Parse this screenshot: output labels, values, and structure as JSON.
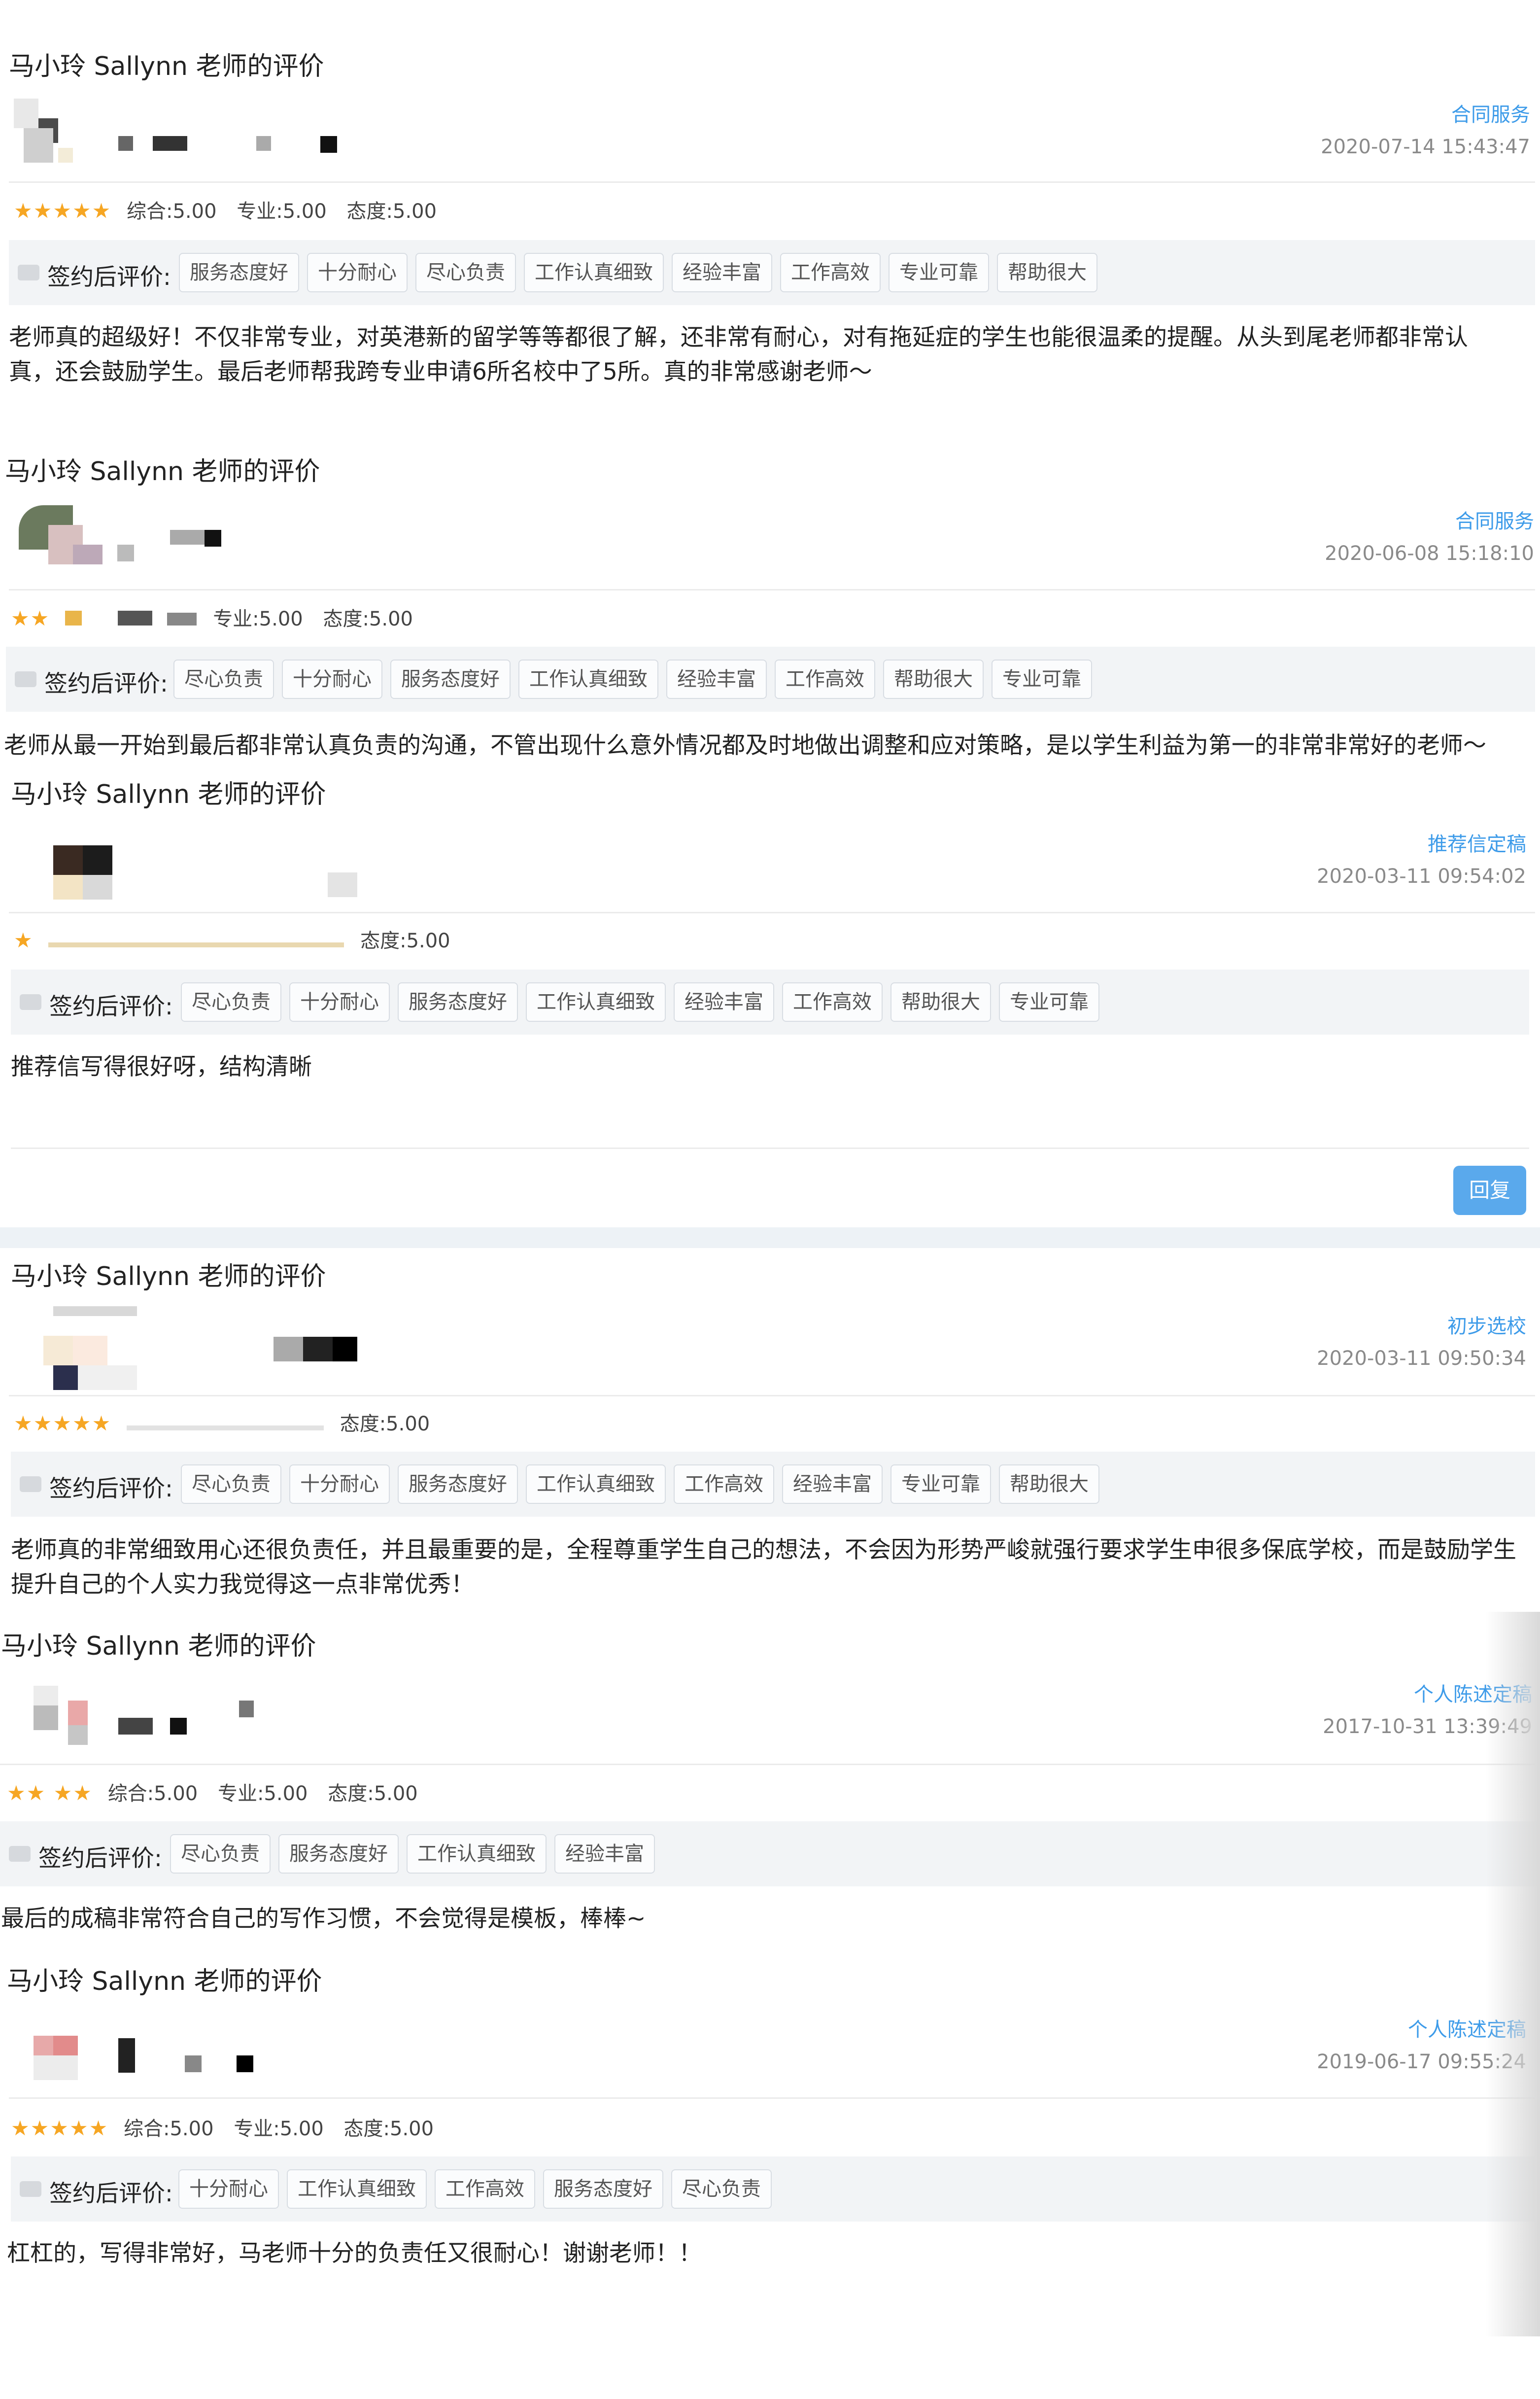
{
  "colors": {
    "accent": "#3d9be9",
    "star": "#f6a623",
    "tag_bar": "#f2f4f6",
    "button": "#5aa9ec"
  },
  "reviews": [
    {
      "title": "马小玲 Sallynn 老师的评价",
      "service": "合同服务",
      "date": "2020-07-14 15:43:47",
      "scores": {
        "overall": "综合:5.00",
        "professional": "专业:5.00",
        "attitude": "态度:5.00"
      },
      "tag_label": "签约后评价:",
      "tags": [
        "服务态度好",
        "十分耐心",
        "尽心负责",
        "工作认真细致",
        "经验丰富",
        "工作高效",
        "专业可靠",
        "帮助很大"
      ],
      "text": "老师真的超级好！不仅非常专业，对英港新的留学等等都很了解，还非常有耐心，对有拖延症的学生也能很温柔的提醒。从头到尾老师都非常认真，还会鼓励学生。最后老师帮我跨专业申请6所名校中了5所。真的非常感谢老师～"
    },
    {
      "title": "马小玲 Sallynn 老师的评价",
      "service": "合同服务",
      "date": "2020-06-08 15:18:10",
      "scores": {
        "overall": "",
        "professional": "专业:5.00",
        "attitude": "态度:5.00"
      },
      "tag_label": "签约后评价:",
      "tags": [
        "尽心负责",
        "十分耐心",
        "服务态度好",
        "工作认真细致",
        "经验丰富",
        "工作高效",
        "帮助很大",
        "专业可靠"
      ],
      "text": "老师从最一开始到最后都非常认真负责的沟通，不管出现什么意外情况都及时地做出调整和应对策略，是以学生利益为第一的非常非常好的老师～"
    },
    {
      "title": "马小玲 Sallynn 老师的评价",
      "service": "推荐信定稿",
      "date": "2020-03-11 09:54:02",
      "scores": {
        "overall": "",
        "professional": "",
        "attitude": "态度:5.00"
      },
      "tag_label": "签约后评价:",
      "tags": [
        "尽心负责",
        "十分耐心",
        "服务态度好",
        "工作认真细致",
        "经验丰富",
        "工作高效",
        "帮助很大",
        "专业可靠"
      ],
      "text": "推荐信写得很好呀，结构清晰",
      "reply": "回复"
    },
    {
      "title": "马小玲 Sallynn 老师的评价",
      "service": "初步选校",
      "date": "2020-03-11 09:50:34",
      "scores": {
        "overall": "",
        "professional": "",
        "attitude": "态度:5.00"
      },
      "tag_label": "签约后评价:",
      "tags": [
        "尽心负责",
        "十分耐心",
        "服务态度好",
        "工作认真细致",
        "工作高效",
        "经验丰富",
        "专业可靠",
        "帮助很大"
      ],
      "text": "老师真的非常细致用心还很负责任，并且最重要的是，全程尊重学生自己的想法，不会因为形势严峻就强行要求学生申很多保底学校，而是鼓励学生提升自己的个人实力我觉得这一点非常优秀！"
    },
    {
      "title": "马小玲 Sallynn 老师的评价",
      "service": "个人陈述定稿",
      "date": "2017-10-31 13:39:49",
      "scores": {
        "overall": "综合:5.00",
        "professional": "专业:5.00",
        "attitude": "态度:5.00"
      },
      "tag_label": "签约后评价:",
      "tags": [
        "尽心负责",
        "服务态度好",
        "工作认真细致",
        "经验丰富"
      ],
      "text": "最后的成稿非常符合自己的写作习惯，不会觉得是模板，棒棒~"
    },
    {
      "title": "马小玲 Sallynn 老师的评价",
      "service": "个人陈述定稿",
      "date": "2019-06-17 09:55:24",
      "scores": {
        "overall": "综合:5.00",
        "professional": "专业:5.00",
        "attitude": "态度:5.00"
      },
      "tag_label": "签约后评价:",
      "tags": [
        "十分耐心",
        "工作认真细致",
        "工作高效",
        "服务态度好",
        "尽心负责"
      ],
      "text": "杠杠的，写得非常好，马老师十分的负责任又很耐心！谢谢老师！！"
    }
  ]
}
